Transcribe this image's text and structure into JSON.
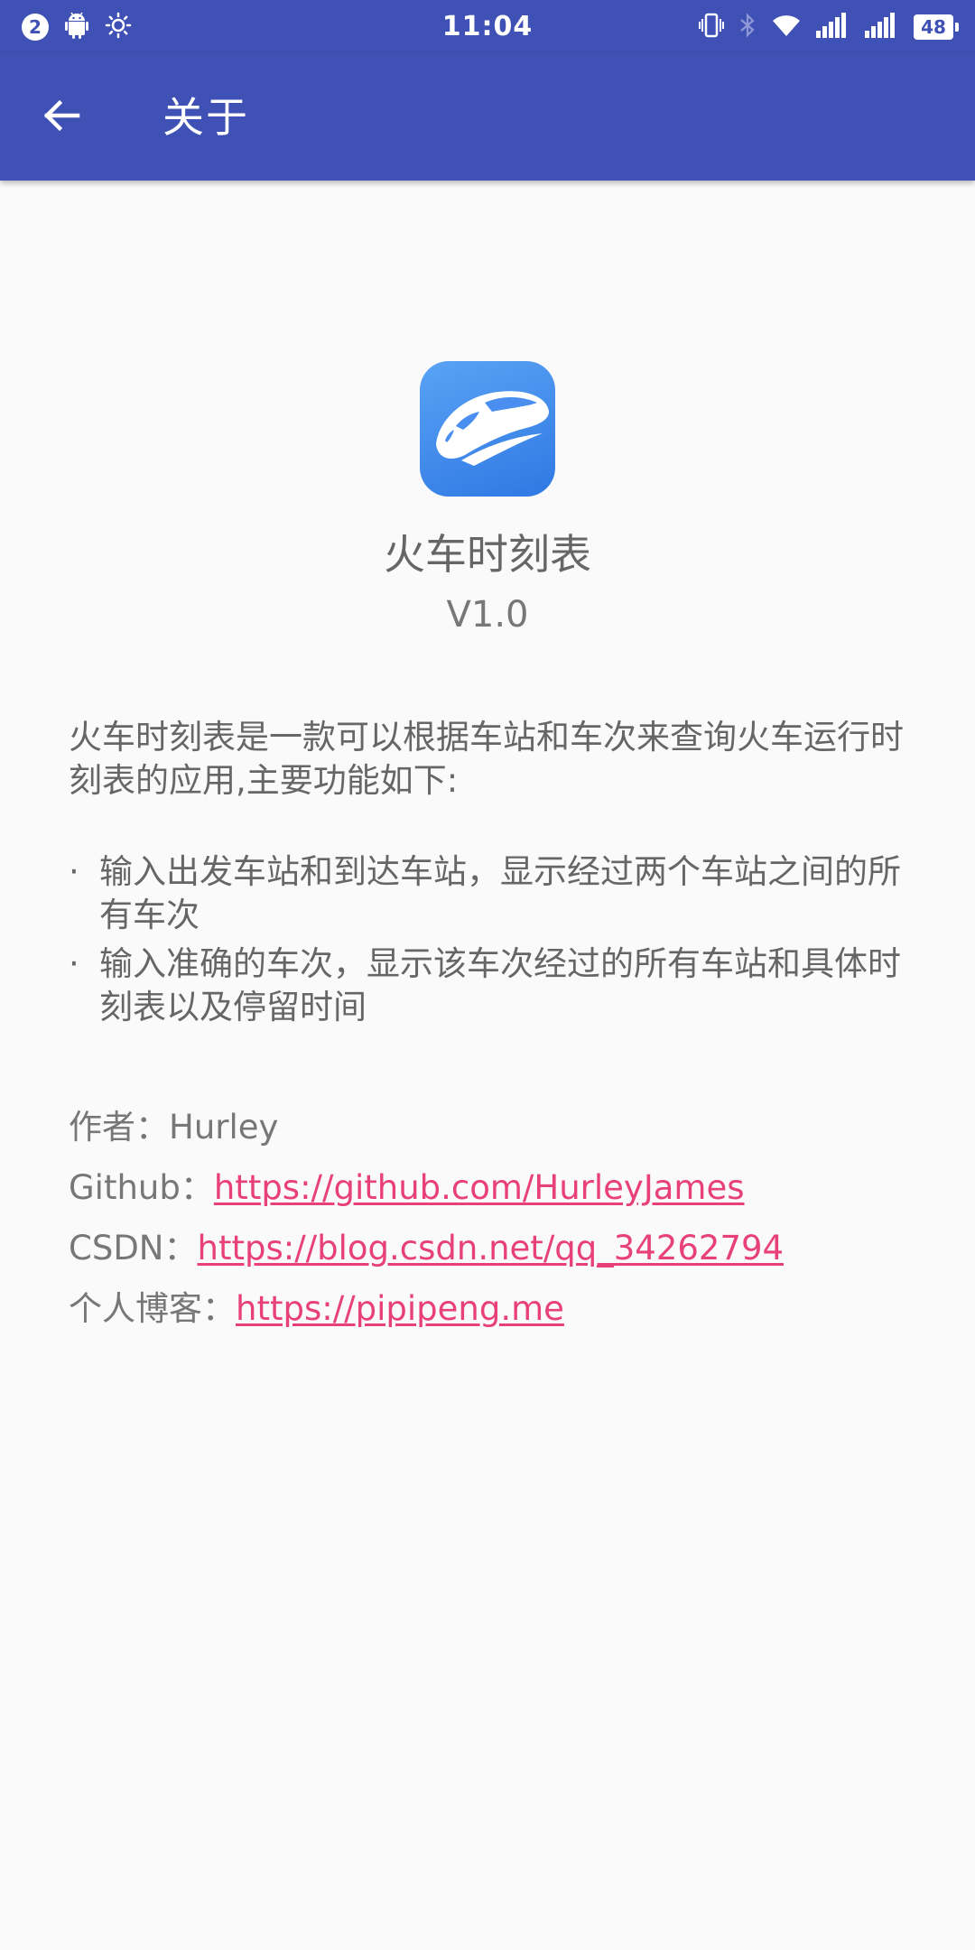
{
  "status_bar": {
    "notification_count": "2",
    "time": "11:04",
    "battery": "48",
    "icons": [
      "android-icon",
      "brightness-icon",
      "vibrate-icon",
      "bluetooth-icon",
      "wifi-icon",
      "signal-icon"
    ]
  },
  "app_bar": {
    "title": "关于",
    "back_icon": "arrow-left-icon",
    "color": "#3f51b5"
  },
  "app": {
    "name": "火车时刻表",
    "version": "V1.0",
    "icon": "train-icon"
  },
  "description": "火车时刻表是一款可以根据车站和车次来查询火车运行时刻表的应用,主要功能如下:",
  "features": [
    {
      "bullet": "·",
      "text": "输入出发车站和到达车站，显示经过两个车站之间的所有车次"
    },
    {
      "bullet": "·",
      "text": "输入准确的车次，显示该车次经过的所有车站和具体时刻表以及停留时间"
    }
  ],
  "info": {
    "author_label": "作者：",
    "author_value": "Hurley",
    "github_label": "Github：",
    "github_url": "https://github.com/HurleyJames",
    "csdn_label": "CSDN：",
    "csdn_url": "https://blog.csdn.net/qq_34262794",
    "blog_label": "个人博客：",
    "blog_url": "https://pipipeng.me"
  },
  "colors": {
    "primary": "#3f51b5",
    "link": "#e8407a",
    "text": "#666666",
    "background": "#fafafa"
  }
}
